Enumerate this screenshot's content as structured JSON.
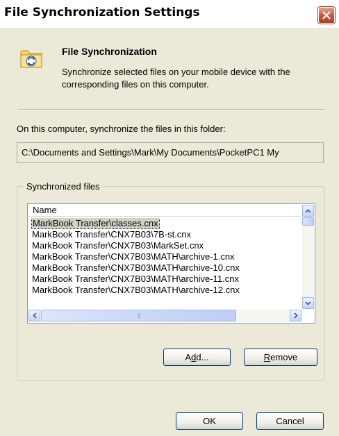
{
  "window": {
    "title": "File Synchronization Settings",
    "close_icon": "close-icon"
  },
  "header": {
    "icon": "sync-folder-icon",
    "title": "File Synchronization",
    "description": "Synchronize selected files on your mobile device with the corresponding files on this computer."
  },
  "folder": {
    "label": "On this computer, synchronize the files in this folder:",
    "path": "C:\\Documents and Settings\\Mark\\My Documents\\PocketPC1 My"
  },
  "synchronized_files": {
    "group_label": "Synchronized files",
    "column_header": "Name",
    "items": [
      {
        "label": "MarkBook Transfer\\classes.cnx"
      },
      {
        "label": "MarkBook Transfer\\CNX7B03\\7B-st.cnx"
      },
      {
        "label": "MarkBook Transfer\\CNX7B03\\MarkSet.cnx"
      },
      {
        "label": "MarkBook Transfer\\CNX7B03\\MATH\\archive-1.cnx"
      },
      {
        "label": "MarkBook Transfer\\CNX7B03\\MATH\\archive-10.cnx"
      },
      {
        "label": "MarkBook Transfer\\CNX7B03\\MATH\\archive-11.cnx"
      },
      {
        "label": "MarkBook Transfer\\CNX7B03\\MATH\\archive-12.cnx"
      }
    ],
    "selected_index": 0,
    "add_button": {
      "prefix": "A",
      "mnemonic": "d",
      "suffix": "d..."
    },
    "remove_button": {
      "prefix": "",
      "mnemonic": "R",
      "suffix": "emove"
    }
  },
  "footer": {
    "ok_label": "OK",
    "cancel_label": "Cancel"
  },
  "colors": {
    "dialog_bg": "#ece9d8",
    "close_button": "#c8553c",
    "button_border": "#003c74",
    "list_border": "#7f9db9"
  }
}
